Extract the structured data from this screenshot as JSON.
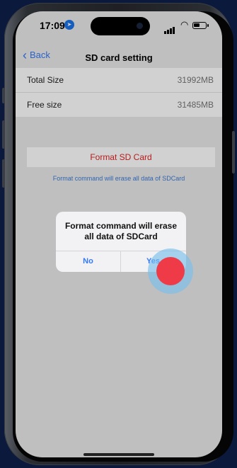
{
  "status_bar": {
    "time": "17:09"
  },
  "nav": {
    "back_label": "Back",
    "title": "SD card setting"
  },
  "storage": [
    {
      "label": "Total Size",
      "value": "31992MB"
    },
    {
      "label": "Free size",
      "value": "31485MB"
    }
  ],
  "format": {
    "button_label": "Format SD Card",
    "note": "Format command will erase all data of SDCard"
  },
  "dialog": {
    "message": "Format command will erase all data of SDCard",
    "no_label": "No",
    "yes_label": "Yes"
  },
  "colors": {
    "accent": "#3478f6",
    "danger": "#e02424",
    "touch_indicator": "#ef3b48"
  }
}
